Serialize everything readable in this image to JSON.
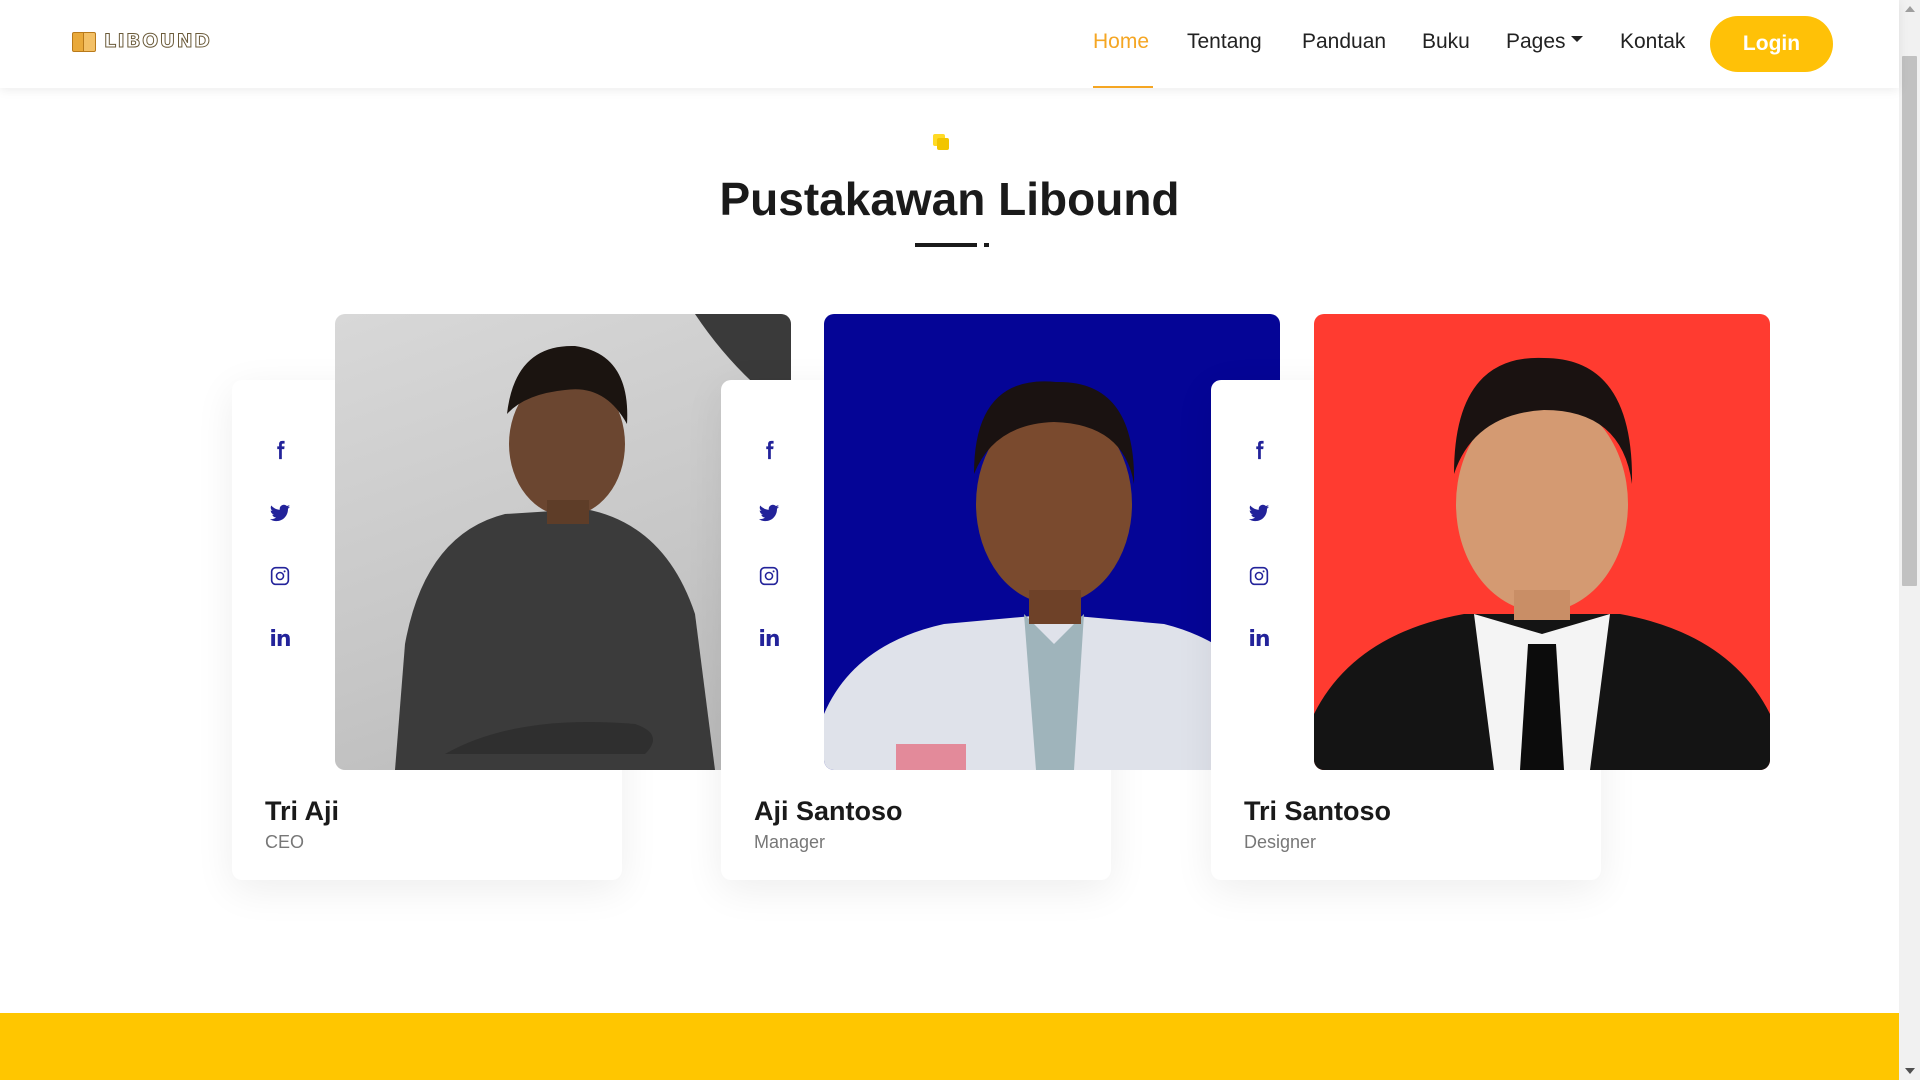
{
  "brand": {
    "name": "LIBOUND",
    "icon": "book-icon"
  },
  "nav": {
    "items": [
      "Home",
      "Tentang",
      "Panduan",
      "Buku",
      "Pages",
      "Kontak"
    ],
    "active": "Home",
    "login_label": "Login"
  },
  "section": {
    "title": "Pustakawan Libound"
  },
  "team": [
    {
      "name": "Tri Aji",
      "role": "CEO",
      "photo_bg": "#c9c9c9",
      "socials": [
        "facebook-icon",
        "twitter-icon",
        "instagram-icon",
        "linkedin-icon"
      ]
    },
    {
      "name": "Aji Santoso",
      "role": "Manager",
      "photo_bg": "#050596",
      "socials": [
        "facebook-icon",
        "twitter-icon",
        "instagram-icon",
        "linkedin-icon"
      ]
    },
    {
      "name": "Tri Santoso",
      "role": "Designer",
      "photo_bg": "#ff3b30",
      "socials": [
        "facebook-icon",
        "twitter-icon",
        "instagram-icon",
        "linkedin-icon"
      ]
    }
  ],
  "colors": {
    "accent": "#ffc107",
    "active_nav": "#f5a623",
    "social": "#23239a",
    "band": "#ffc600"
  }
}
